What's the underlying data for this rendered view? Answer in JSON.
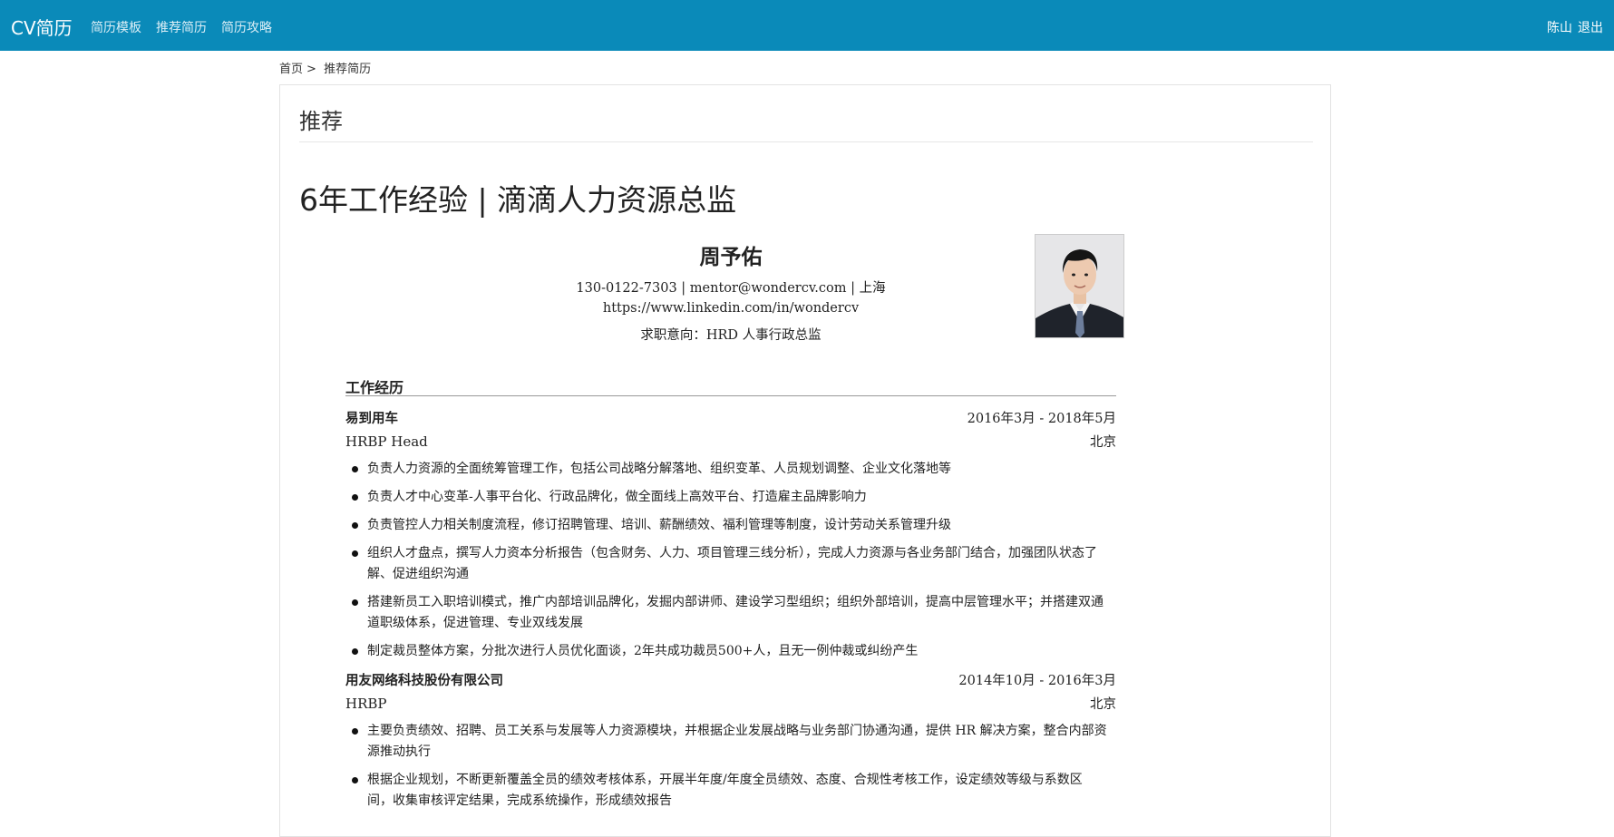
{
  "nav": {
    "brand": "CV简历",
    "links": [
      "简历模板",
      "推荐简历",
      "简历攻略"
    ],
    "user": "陈山",
    "logout": "退出"
  },
  "breadcrumb": {
    "home": "首页",
    "sep": ">",
    "current": "推荐简历"
  },
  "panel": {
    "title": "推荐",
    "headline": "6年工作经验 | 滴滴人力资源总监"
  },
  "resume": {
    "name": "周予佑",
    "contact": "130-0122-7303 | mentor@wondercv.com | 上海",
    "linkedin": "https://www.linkedin.com/in/wondercv",
    "objective": "求职意向：HRD 人事行政总监",
    "section_title": "工作经历",
    "jobs": [
      {
        "company": "易到用车",
        "dates": "2016年3月 - 2018年5月",
        "role": "HRBP Head",
        "location": "北京",
        "bullets": [
          "负责人力资源的全面统筹管理工作，包括公司战略分解落地、组织变革、人员规划调整、企业文化落地等",
          "负责人才中心变革-人事平台化、行政品牌化，做全面线上高效平台、打造雇主品牌影响力",
          "负责管控人力相关制度流程，修订招聘管理、培训、薪酬绩效、福利管理等制度，设计劳动关系管理升级",
          "组织人才盘点，撰写人力资本分析报告（包含财务、人力、项目管理三线分析），完成人力资源与各业务部门结合，加强团队状态了解、促进组织沟通",
          "搭建新员工入职培训模式，推广内部培训品牌化，发掘内部讲师、建设学习型组织；组织外部培训，提高中层管理水平；并搭建双通道职级体系，促进管理、专业双线发展",
          "制定裁员整体方案，分批次进行人员优化面谈，2年共成功裁员500+人，且无一例仲裁或纠纷产生"
        ]
      },
      {
        "company": "用友网络科技股份有限公司",
        "dates": "2014年10月 - 2016年3月",
        "role": "HRBP",
        "location": "北京",
        "bullets": [
          "主要负责绩效、招聘、员工关系与发展等人力资源模块，并根据企业发展战略与业务部门协通沟通，提供 HR 解决方案，整合内部资源推动执行",
          "根据企业规划，不断更新覆盖全员的绩效考核体系，开展半年度/年度全员绩效、态度、合规性考核工作，设定绩效等级与系数区间，收集审核评定结果，完成系统操作，形成绩效报告"
        ]
      }
    ]
  }
}
